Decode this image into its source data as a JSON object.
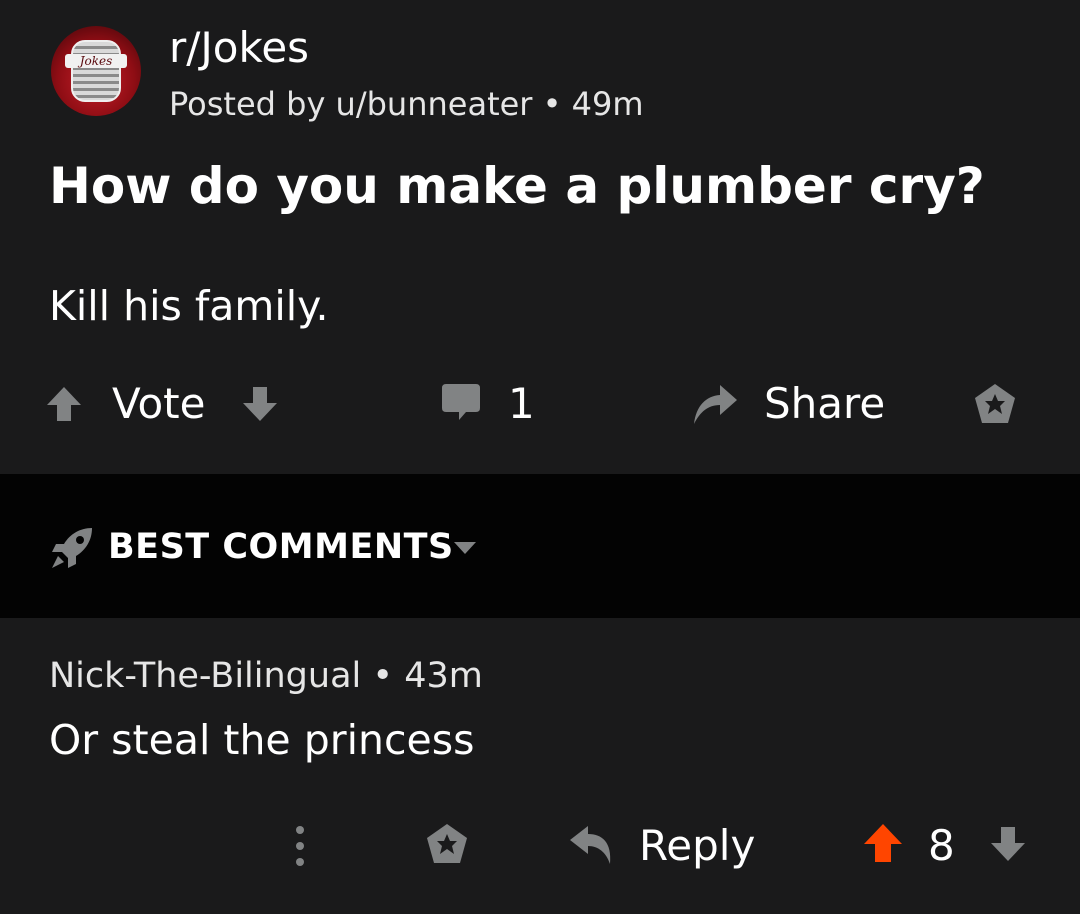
{
  "post": {
    "subreddit": "r/Jokes",
    "avatar_text": "Jokes",
    "posted_by": "Posted by u/bunneater",
    "separator": "•",
    "age": "49m",
    "title": "How do you make a plumber cry?",
    "body": "Kill his family.",
    "actions": {
      "vote_label": "Vote",
      "comment_count": "1",
      "share_label": "Share"
    }
  },
  "sort": {
    "label": "BEST COMMENTS"
  },
  "comment": {
    "author": "Nick-The-Bilingual",
    "separator": "•",
    "age": "43m",
    "body": "Or steal the princess",
    "actions": {
      "reply_label": "Reply",
      "score": "8"
    }
  },
  "colors": {
    "background": "#1a1a1b",
    "sort_bar": "#030303",
    "icon_gray": "#818384",
    "upvote_active": "#ff4500",
    "text": "#ffffff"
  },
  "icons": {
    "upvote": "arrow-up-icon",
    "downvote": "arrow-down-icon",
    "comment": "speech-bubble-icon",
    "share": "share-arrow-icon",
    "award": "award-icon",
    "sort": "rocket-icon",
    "more": "more-vertical-icon",
    "reply": "reply-arrow-icon"
  }
}
